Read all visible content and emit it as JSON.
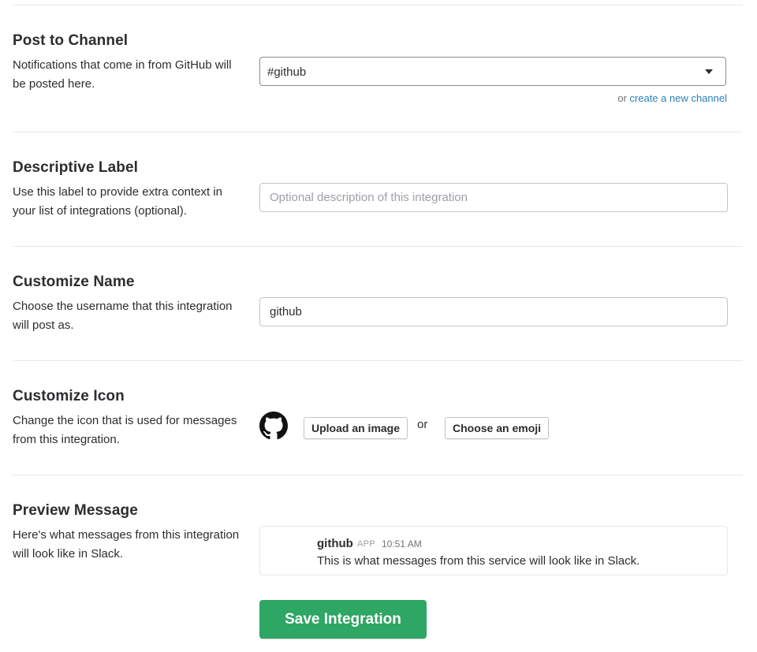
{
  "post_to_channel": {
    "title": "Post to Channel",
    "description": "Notifications that come in from GitHub will be posted here.",
    "selected_channel": "#github",
    "or_text": "or",
    "create_channel_link": "create a new channel"
  },
  "descriptive_label": {
    "title": "Descriptive Label",
    "description": "Use this label to provide extra context in your list of integrations (optional).",
    "value": "",
    "placeholder": "Optional description of this integration"
  },
  "customize_name": {
    "title": "Customize Name",
    "description": "Choose the username that this integration will post as.",
    "value": "github"
  },
  "customize_icon": {
    "title": "Customize Icon",
    "description": "Change the icon that is used for messages from this integration.",
    "icon": "github-icon",
    "upload_label": "Upload an image",
    "or_text": "or",
    "emoji_label": "Choose an emoji"
  },
  "preview_message": {
    "title": "Preview Message",
    "description": "Here's what messages from this integration will look like in Slack.",
    "sender": "github",
    "badge": "APP",
    "time": "10:51 AM",
    "text": "This is what messages from this service will look like in Slack."
  },
  "save_label": "Save Integration",
  "colors": {
    "link": "#2a80b9",
    "save_button": "#2ea664"
  }
}
